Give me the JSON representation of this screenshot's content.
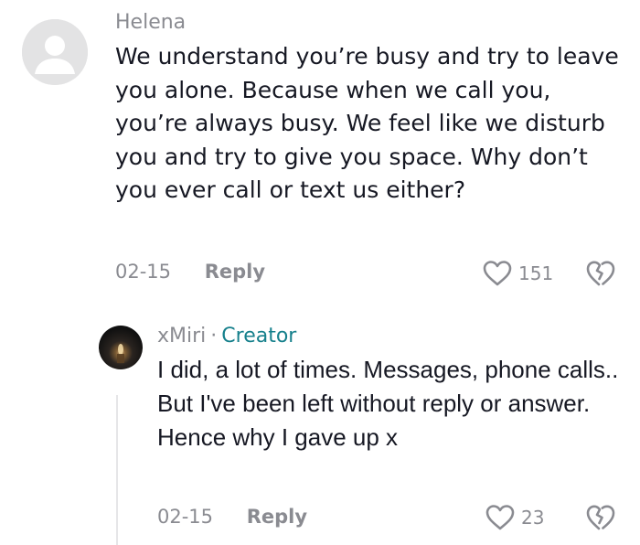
{
  "comments": [
    {
      "username": "Helena",
      "text": "We understand you’re busy and try to leave you alone. Because when we call you, you’re always busy. We feel like we disturb you and try to give you space. Why don’t you ever call or text us either?",
      "date": "02-15",
      "reply_label": "Reply",
      "likes": "151",
      "avatar": "default-avatar-icon"
    },
    {
      "username": "xMiri",
      "separator": "·",
      "badge": "Creator",
      "text": "I did, a lot of times. Messages, phone calls.. But I've been left without reply or answer. Hence why I gave up x",
      "date": "02-15",
      "reply_label": "Reply",
      "likes": "23",
      "avatar": "candle-photo-avatar"
    }
  ],
  "colors": {
    "text": "#161823",
    "muted": "#8a8b91",
    "creator": "#16808c",
    "avatar_bg": "#e3e3e4"
  }
}
